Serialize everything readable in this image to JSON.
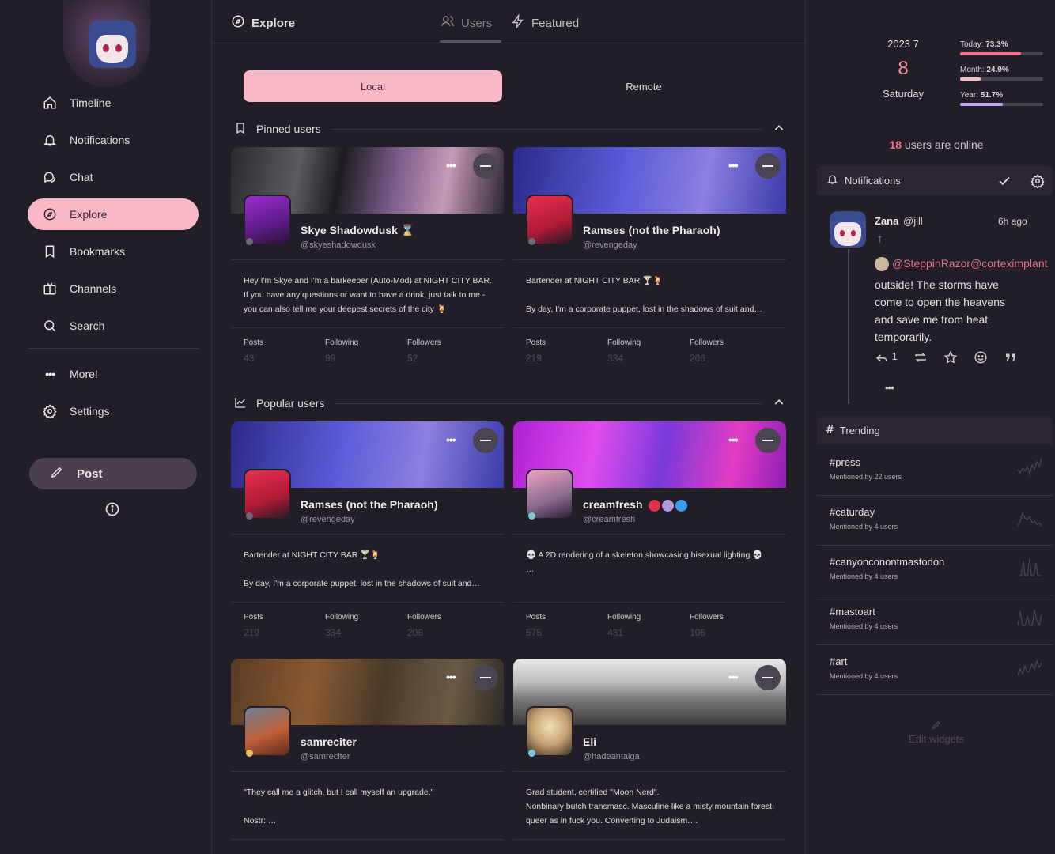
{
  "sidebar": {
    "items": [
      {
        "label": "Timeline",
        "icon": "home-icon"
      },
      {
        "label": "Notifications",
        "icon": "bell-icon"
      },
      {
        "label": "Chat",
        "icon": "chat-icon"
      },
      {
        "label": "Explore",
        "icon": "compass-icon"
      },
      {
        "label": "Bookmarks",
        "icon": "bookmark-icon"
      },
      {
        "label": "Channels",
        "icon": "tv-icon"
      },
      {
        "label": "Search",
        "icon": "search-icon"
      }
    ],
    "more_label": "More!",
    "settings_label": "Settings",
    "post_label": "Post"
  },
  "header": {
    "title": "Explore",
    "tabs": {
      "users": "Users",
      "featured": "Featured"
    }
  },
  "segment": {
    "local": "Local",
    "remote": "Remote"
  },
  "sections": {
    "pinned": "Pinned users",
    "popular": "Popular users"
  },
  "stats_labels": {
    "posts": "Posts",
    "following": "Following",
    "followers": "Followers"
  },
  "cards": [
    {
      "name": "Skye Shadowdusk ⌛",
      "handle": "@skyeshadowdusk",
      "bio": "Hey I'm Skye and I'm a barkeeper (Auto-Mod) at NIGHT CITY BAR. If you have any questions or want to have a drink, just talk to me - you can also tell me your deepest secrets of the city 🍹",
      "posts": "43",
      "following": "99",
      "followers": "52"
    },
    {
      "name": "Ramses (not the Pharaoh)",
      "handle": "@revengeday",
      "bio": "Bartender at NIGHT CITY BAR 🍸🍹\n\nBy day, I'm a corporate puppet, lost in the shadows of suit and…",
      "posts": "219",
      "following": "334",
      "followers": "206"
    },
    {
      "name": "Ramses (not the Pharaoh)",
      "handle": "@revengeday",
      "bio": "Bartender at NIGHT CITY BAR 🍸🍹\n\nBy day, I'm a corporate puppet, lost in the shadows of suit and…",
      "posts": "219",
      "following": "334",
      "followers": "206"
    },
    {
      "name": "creamfresh",
      "handle": "@creamfresh",
      "bio": "💀 A 2D rendering of a skeleton showcasing bisexual lighting 💀\n…",
      "posts": "575",
      "following": "431",
      "followers": "106"
    },
    {
      "name": "samreciter",
      "handle": "@samreciter",
      "bio": "\"They call me a glitch, but I call myself an upgrade.\"\n\nNostr: …",
      "posts": "",
      "following": "",
      "followers": ""
    },
    {
      "name": "Eli",
      "handle": "@hadeantaiga",
      "bio": "Grad student, certified \"Moon Nerd\".\nNonbinary butch transmasc. Masculine like a misty mountain forest, queer as in fuck you. Converting to Judaism.…",
      "posts": "",
      "following": "",
      "followers": ""
    }
  ],
  "calendar": {
    "year_month": "2023 7",
    "day": "8",
    "weekday": "Saturday"
  },
  "progress": [
    {
      "label": "Today:",
      "value": "73.3%",
      "fraction": 0.733,
      "color": "#f0728f"
    },
    {
      "label": "Month:",
      "value": "24.9%",
      "fraction": 0.249,
      "color": "#f4b8c6"
    },
    {
      "label": "Year:",
      "value": "51.7%",
      "fraction": 0.517,
      "color": "#c3a4ef"
    }
  ],
  "online": {
    "count": "18",
    "text": "users are online"
  },
  "notifications": {
    "title": "Notifications",
    "item": {
      "name": "Zana",
      "handle": "@jill",
      "time": "6h ago",
      "mention": "@SteppinRazor@corteximplant",
      "text": "outside! The storms have come to open the heavens and save me from heat temporarily.",
      "reply_count": "1"
    }
  },
  "trending": {
    "title": "Trending",
    "items": [
      {
        "tag": "#press",
        "sub": "Mentioned by 22 users"
      },
      {
        "tag": "#caturday",
        "sub": "Mentioned by 4 users"
      },
      {
        "tag": "#canyonconontmastodon",
        "sub": "Mentioned by 4 users"
      },
      {
        "tag": "#mastoart",
        "sub": "Mentioned by 4 users"
      },
      {
        "tag": "#art",
        "sub": "Mentioned by 4 users"
      }
    ]
  },
  "edit_widgets": "Edit widgets"
}
